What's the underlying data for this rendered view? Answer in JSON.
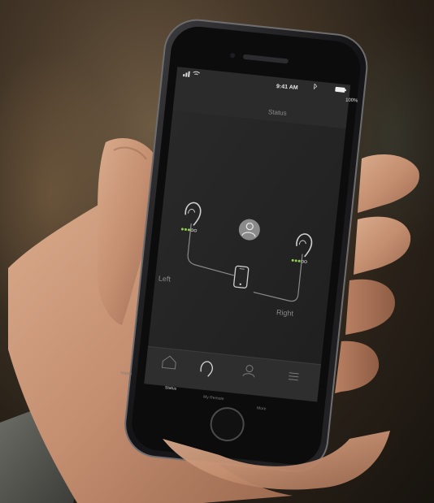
{
  "status_bar": {
    "time": "9:41 AM",
    "battery": "100%"
  },
  "nav": {
    "title": "Status"
  },
  "hearing_aids": {
    "left_label": "Left",
    "right_label": "Right",
    "left_signal": {
      "filled": 3,
      "total": 5
    },
    "right_signal": {
      "filled": 3,
      "total": 5
    }
  },
  "tab_bar": {
    "items": [
      {
        "label": "Home",
        "icon": "home-icon",
        "active": false
      },
      {
        "label": "Status",
        "icon": "hearing-aid-icon",
        "active": true
      },
      {
        "label": "My Remote",
        "icon": "person-icon",
        "active": false
      },
      {
        "label": "More",
        "icon": "menu-icon",
        "active": false
      }
    ]
  },
  "colors": {
    "signal_active": "#8fd14f",
    "screen_bg": "#252525",
    "tab_bar_bg": "#2e2e2e"
  }
}
